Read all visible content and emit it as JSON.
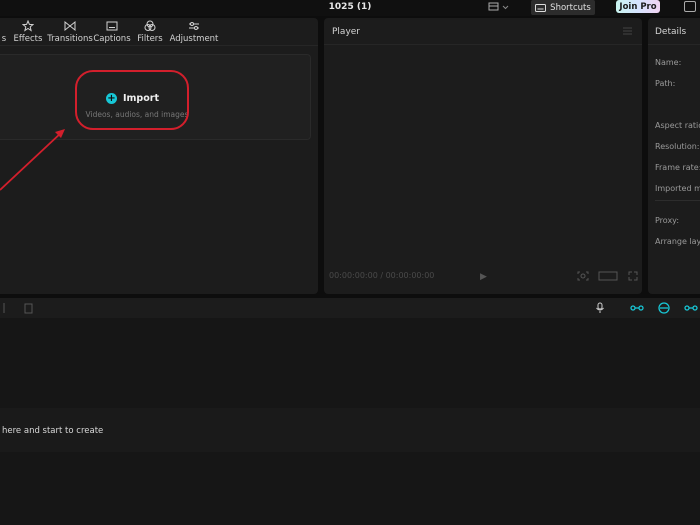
{
  "window": {
    "title": "1025 (1)"
  },
  "titlebar": {
    "shortcuts_label": "Shortcuts",
    "join_pro_label": "Join Pro",
    "colors": {
      "join_pro_gradient": [
        "#c9f4ef",
        "#d6e4ff",
        "#f0d3f2"
      ]
    }
  },
  "media_toolbar": {
    "items": [
      {
        "label": "s",
        "icon": "media-tab-partial"
      },
      {
        "label": "Effects",
        "icon": "effects-star-icon"
      },
      {
        "label": "Transitions",
        "icon": "transitions-bowtie-icon"
      },
      {
        "label": "Captions",
        "icon": "captions-icon"
      },
      {
        "label": "Filters",
        "icon": "filters-circles-icon"
      },
      {
        "label": "Adjustment",
        "icon": "adjustment-sliders-icon"
      }
    ]
  },
  "import": {
    "label": "Import",
    "subtitle": "Videos, audios, and images",
    "accent_color": "#17c7d6",
    "highlight_color": "#d31f2c"
  },
  "player": {
    "title": "Player",
    "time": "00:00:00:00 / 00:00:00:00"
  },
  "details": {
    "title": "Details",
    "labels": [
      "Name:",
      "Path:",
      "Aspect ratio:",
      "Resolution:",
      "Frame rate:",
      "Imported media:",
      "Proxy:",
      "Arrange layers:"
    ]
  },
  "timeline": {
    "hint": "here and start to create"
  }
}
